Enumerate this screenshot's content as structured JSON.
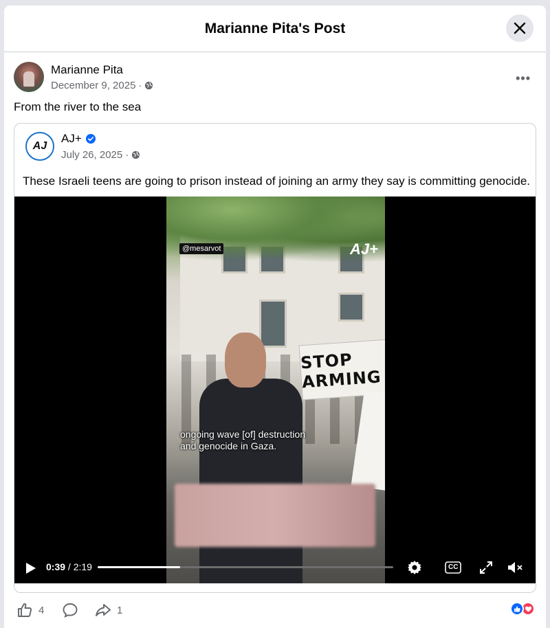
{
  "modal": {
    "title": "Marianne Pita's Post"
  },
  "post": {
    "author": "Marianne Pita",
    "date": "December 9, 2025",
    "separator": "·",
    "text": "From the river to the sea",
    "more_label": "•••"
  },
  "shared": {
    "author": "AJ+",
    "logo_text": "AJ",
    "date": "July 26, 2025",
    "separator": "·",
    "text": "These Israeli teens are going to prison instead of joining an army they say is committing genocide."
  },
  "video": {
    "handle": "@mesarvot",
    "overlay_logo": "AJ+",
    "banner_text": "STOP ARMING",
    "caption_line1": "ongoing wave [of] destruction",
    "caption_line2": "and genocide in Gaza.",
    "current_time": "0:39",
    "total_time": "/ 2:19",
    "progress_fraction": 0.28,
    "cc_label": "CC"
  },
  "footer": {
    "like_count": "4",
    "share_count": "1"
  },
  "colors": {
    "accent": "#0866ff",
    "love": "#f33e58",
    "verified": "#0866ff"
  }
}
